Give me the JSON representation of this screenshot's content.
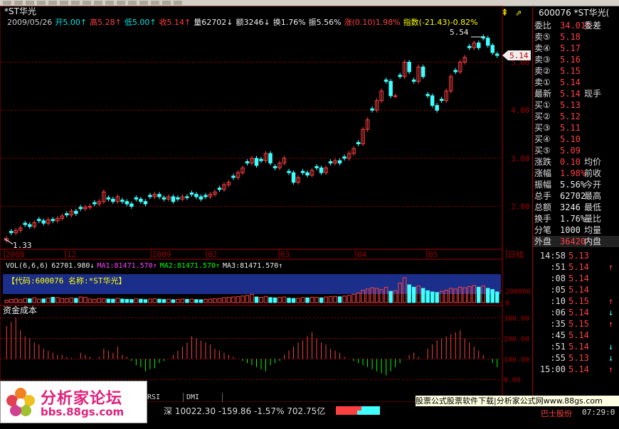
{
  "window": {
    "stock_name": "*ST华光"
  },
  "header": {
    "title": "*ST华光",
    "line2": [
      {
        "text": "2009/05/26",
        "color": "#cccccc"
      },
      {
        "text": "开5.00↑",
        "color": "#00e8e8"
      },
      {
        "text": "高5.28↑",
        "color": "#ff4040"
      },
      {
        "text": "低5.00↑",
        "color": "#00e8e8"
      },
      {
        "text": "收5.14↑",
        "color": "#ff4040"
      },
      {
        "text": "量62702↓",
        "color": "#eeeeee"
      },
      {
        "text": "额3246↓",
        "color": "#eeeeee"
      },
      {
        "text": "换1.76%",
        "color": "#eeeeee"
      },
      {
        "text": "振5.56%",
        "color": "#eeeeee"
      },
      {
        "text": "涨(0.10)1.98%",
        "color": "#ff4040"
      },
      {
        "text": "指数(-21.43)-0.82%",
        "color": "#ffff00"
      }
    ]
  },
  "chart_data": [
    {
      "type": "candlestick",
      "title": "*ST华光",
      "y_ticks": [
        "5.00",
        "4.00",
        "3.00",
        "2.00"
      ],
      "ylim": [
        1.15,
        5.85
      ],
      "x_ticks": [
        "2008",
        "12",
        "2009",
        "02",
        "03",
        "04",
        "05",
        "日线"
      ],
      "annotations": {
        "max_label": "5.54",
        "min_label": "1.33",
        "last_price": "5.14"
      },
      "closes": [
        1.33,
        1.45,
        1.5,
        1.55,
        1.62,
        1.58,
        1.66,
        1.7,
        1.65,
        1.72,
        1.7,
        1.75,
        1.8,
        1.82,
        1.9,
        1.85,
        1.95,
        1.98,
        2.0,
        2.05,
        2.1,
        2.3,
        2.15,
        2.1,
        2.2,
        2.1,
        2.05,
        2.0,
        2.15,
        2.1,
        2.05,
        2.2,
        2.25,
        2.2,
        2.15,
        2.2,
        2.1,
        2.15,
        2.2,
        2.18,
        2.25,
        2.2,
        2.15,
        2.2,
        2.25,
        2.3,
        2.35,
        2.45,
        2.5,
        2.6,
        2.7,
        2.8,
        2.9,
        3.0,
        2.85,
        2.95,
        3.1,
        2.9,
        2.8,
        2.9,
        3.0,
        2.7,
        2.5,
        2.6,
        2.7,
        2.65,
        2.75,
        2.8,
        2.7,
        2.8,
        2.9,
        2.95,
        2.9,
        3.0,
        3.1,
        3.2,
        3.3,
        3.6,
        3.8,
        4.0,
        4.2,
        4.4,
        4.6,
        4.3,
        4.3,
        4.7,
        5.0,
        4.8,
        4.6,
        4.9,
        4.7,
        4.3,
        4.1,
        4.0,
        4.2,
        4.4,
        4.7,
        4.8,
        5.0,
        5.1,
        5.3,
        5.4,
        5.3,
        5.5,
        5.35,
        5.2,
        5.14
      ],
      "volume_header": [
        {
          "text": "VOL(6,6,6)",
          "color": "#eeeeee"
        },
        {
          "text": "62701.980↓",
          "color": "#eeeeee"
        },
        {
          "text": "MA1:81471.570↑",
          "color": "#ff40ff"
        },
        {
          "text": "MA2:81471.570↑",
          "color": "#00ff00"
        },
        {
          "text": "MA3:81471.570↑",
          "color": "#eeeeee"
        }
      ],
      "volume_banner": "【代码:600076 名称:*ST华光】",
      "volume_ticks": [
        "200000",
        "0"
      ],
      "volume_values": [
        40,
        55,
        60,
        48,
        70,
        65,
        80,
        58,
        62,
        75,
        90,
        85,
        70,
        66,
        80,
        72,
        95,
        88,
        60,
        55,
        70,
        65,
        60,
        58,
        72,
        60,
        55,
        52,
        62,
        58,
        50,
        60,
        64,
        58,
        52,
        56,
        48,
        54,
        60,
        55,
        58,
        50,
        48,
        55,
        60,
        64,
        70,
        82,
        88,
        95,
        100,
        110,
        120,
        140,
        95,
        90,
        105,
        85,
        80,
        88,
        95,
        75,
        70,
        72,
        85,
        80,
        90,
        88,
        80,
        95,
        100,
        105,
        98,
        110,
        120,
        140,
        160,
        210,
        230,
        250,
        240,
        220,
        260,
        190,
        200,
        330,
        420,
        300,
        260,
        280,
        240,
        200,
        180,
        170,
        190,
        210,
        240,
        230,
        260,
        250,
        270,
        290,
        260,
        280,
        240,
        220,
        180
      ]
    },
    {
      "type": "bar",
      "title": "资金成本",
      "y_ticks": [
        "300.00",
        "200.00",
        "100.00",
        "0.00"
      ],
      "ylim": [
        -20,
        340
      ],
      "baseline": 100,
      "values": [
        260,
        280,
        300,
        240,
        210,
        200,
        180,
        170,
        150,
        140,
        130,
        120,
        120,
        110,
        105,
        100,
        130,
        120,
        110,
        100,
        110,
        150,
        140,
        130,
        160,
        120,
        110,
        90,
        70,
        60,
        40,
        50,
        55,
        80,
        90,
        100,
        120,
        140,
        160,
        180,
        210,
        200,
        190,
        180,
        170,
        150,
        140,
        130,
        120,
        110,
        100,
        90,
        80,
        70,
        60,
        50,
        40,
        70,
        80,
        90,
        120,
        140,
        160,
        180,
        190,
        210,
        230,
        200,
        180,
        170,
        150,
        140,
        130,
        110,
        100,
        90,
        80,
        70,
        60,
        50,
        40,
        30,
        20,
        40,
        60,
        80,
        100,
        120,
        130,
        110,
        100,
        150,
        170,
        190,
        200,
        210,
        220,
        230,
        240,
        200,
        180,
        160,
        140,
        120,
        100,
        80,
        60
      ]
    }
  ],
  "quote": {
    "code_title": "600076 *ST华光(",
    "weibi": {
      "label": "委比",
      "value": "34.01%",
      "label2": "委差"
    },
    "sell": [
      {
        "label": "卖⑤",
        "price": "5.18"
      },
      {
        "label": "卖④",
        "price": "5.17"
      },
      {
        "label": "卖③",
        "price": "5.16"
      },
      {
        "label": "卖②",
        "price": "5.15"
      },
      {
        "label": "卖①",
        "price": "5.14"
      }
    ],
    "latest": {
      "label": "最新",
      "value": "5.14",
      "label2": "现手"
    },
    "buy": [
      {
        "label": "买①",
        "price": "5.13"
      },
      {
        "label": "买②",
        "price": "5.12"
      },
      {
        "label": "买③",
        "price": "5.11"
      },
      {
        "label": "买④",
        "price": "5.10"
      },
      {
        "label": "买⑤",
        "price": "5.09"
      }
    ],
    "stats": [
      {
        "label": "涨跌",
        "value": "0.10",
        "label2": "均价",
        "color": "#ff4040"
      },
      {
        "label": "涨幅",
        "value": "1.98%",
        "label2": "前收",
        "color": "#ff4040"
      },
      {
        "label": "振幅",
        "value": "5.56%",
        "label2": "今开",
        "color": "#eeeeee"
      },
      {
        "label": "总手",
        "value": "62702",
        "label2": "最高",
        "color": "#eeeeee"
      },
      {
        "label": "总额",
        "value": "3246",
        "label2": "最低",
        "color": "#eeeeee"
      },
      {
        "label": "换手",
        "value": "1.76%",
        "label2": "量比",
        "color": "#eeeeee"
      },
      {
        "label": "分笔",
        "value": "1000",
        "label2": "均量",
        "color": "#eeeeee"
      }
    ],
    "waipan": {
      "label": "外盘",
      "value": "36420",
      "label2": "内盘"
    },
    "ticks": [
      {
        "time": "14:58",
        "price": "5.13",
        "arrow": ""
      },
      {
        "time": ":51",
        "price": "5.14",
        "arrow": "↑"
      },
      {
        "time": ":08",
        "price": "5.14",
        "arrow": ""
      },
      {
        "time": ":05",
        "price": "5.14",
        "arrow": ""
      },
      {
        "time": ":10",
        "price": "5.15",
        "arrow": "↑"
      },
      {
        "time": ":06",
        "price": "5.14",
        "arrow": "↓"
      },
      {
        "time": ":35",
        "price": "5.15",
        "arrow": "↑"
      },
      {
        "time": ":45",
        "price": "5.14",
        "arrow": ""
      },
      {
        "time": ":51",
        "price": "5.14",
        "arrow": "↓"
      },
      {
        "time": ":55",
        "price": "5.13",
        "arrow": "↓"
      },
      {
        "time": "15:00",
        "price": "5.14",
        "arrow": "↑"
      }
    ]
  },
  "bottom": {
    "logo_title": "分析家论坛",
    "logo_url": "bbs.88gs.com",
    "tabs": [
      "RSI",
      "DMI"
    ],
    "index_text": "深 10022.30  -159.86  -1.57% 702.75亿",
    "ad_text": "股票公式股票软件下载|分析家公式网www.88gs.com",
    "right_text": "巴士股份",
    "time_text": "07:29:0"
  },
  "colors": {
    "up": "#ff4040",
    "down": "#40ffff",
    "grid": "#a00000",
    "yellow": "#ffff00",
    "green": "#00ff00"
  }
}
